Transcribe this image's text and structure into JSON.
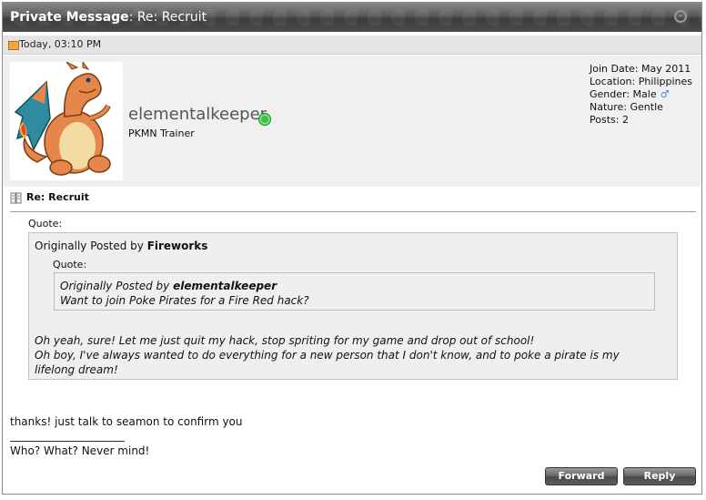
{
  "header": {
    "label": "Private Message",
    "subject": "Re: Recruit"
  },
  "meta": {
    "date": "Today, 03:10 PM"
  },
  "user": {
    "name": "elementalkeeper",
    "title": "PKMN Trainer",
    "stats": [
      "Join Date: May 2011",
      "Location: Philippines",
      "Gender: Male",
      "Nature: Gentle",
      "Posts: 2"
    ],
    "gender_icon": "♂"
  },
  "post": {
    "title": "Re: Recruit",
    "quote_label": "Quote:",
    "outer_quote": {
      "prefix": "Originally Posted by",
      "author": "Fireworks",
      "quote_label": "Quote:",
      "inner_quote": {
        "prefix": "Originally Posted by",
        "author": "elementalkeeper",
        "text": "Want to join Poke Pirates for a Fire Red hack?"
      },
      "reply_lines": [
        "Oh yeah, sure! Let me just quit my hack, stop spriting for my game and drop out of school!",
        "Oh boy, I've always wanted to do everything for a new person that I don't know, and to poke a pirate is my lifelong dream!"
      ]
    },
    "message": "thanks! just talk to seamon to confirm you",
    "signature": "Who? What? Never mind!"
  },
  "buttons": {
    "forward": "Forward",
    "reply": "Reply"
  },
  "colors": {
    "online": "#3fbf4b",
    "titlebar": "#4b4b4b",
    "panel": "#f0f0f0"
  }
}
